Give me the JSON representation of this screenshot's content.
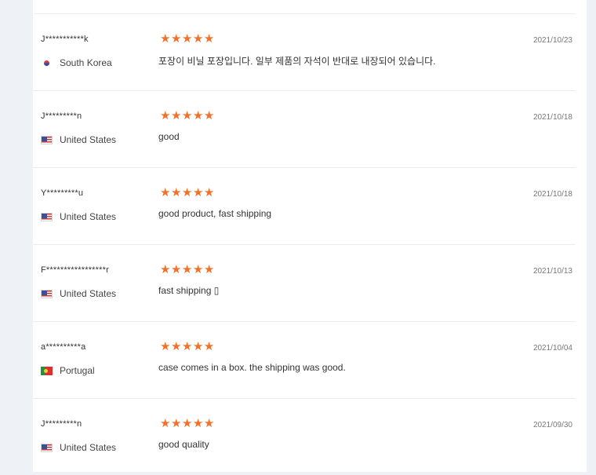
{
  "reviews": [
    {
      "user": "J***********k",
      "country": "South Korea",
      "flag": "kr-flag-icon",
      "rating": 5,
      "text": "포장이 비닐 포장입니다. 일부 제품의 자석이 반대로 내장되어 있습니다.",
      "date": "2021/10/23"
    },
    {
      "user": "J*********n",
      "country": "United States",
      "flag": "us-flag-icon",
      "rating": 5,
      "text": "good",
      "date": "2021/10/18"
    },
    {
      "user": "Y*********u",
      "country": "United States",
      "flag": "us-flag-icon",
      "rating": 5,
      "text": "good product, fast shipping",
      "date": "2021/10/18"
    },
    {
      "user": "F*****************r",
      "country": "United States",
      "flag": "us-flag-icon",
      "rating": 5,
      "text": "fast shipping ▯",
      "date": "2021/10/13"
    },
    {
      "user": "a**********a",
      "country": "Portugal",
      "flag": "pt-flag-icon",
      "rating": 5,
      "text": "case comes in a box. the shipping was good.",
      "date": "2021/10/04"
    },
    {
      "user": "J*********n",
      "country": "United States",
      "flag": "us-flag-icon",
      "rating": 5,
      "text": "good quality",
      "date": "2021/09/30"
    }
  ],
  "star_glyph": "★",
  "colors": {
    "star": "#f0712b",
    "divider": "#ececec",
    "background": "#eef1f6"
  }
}
